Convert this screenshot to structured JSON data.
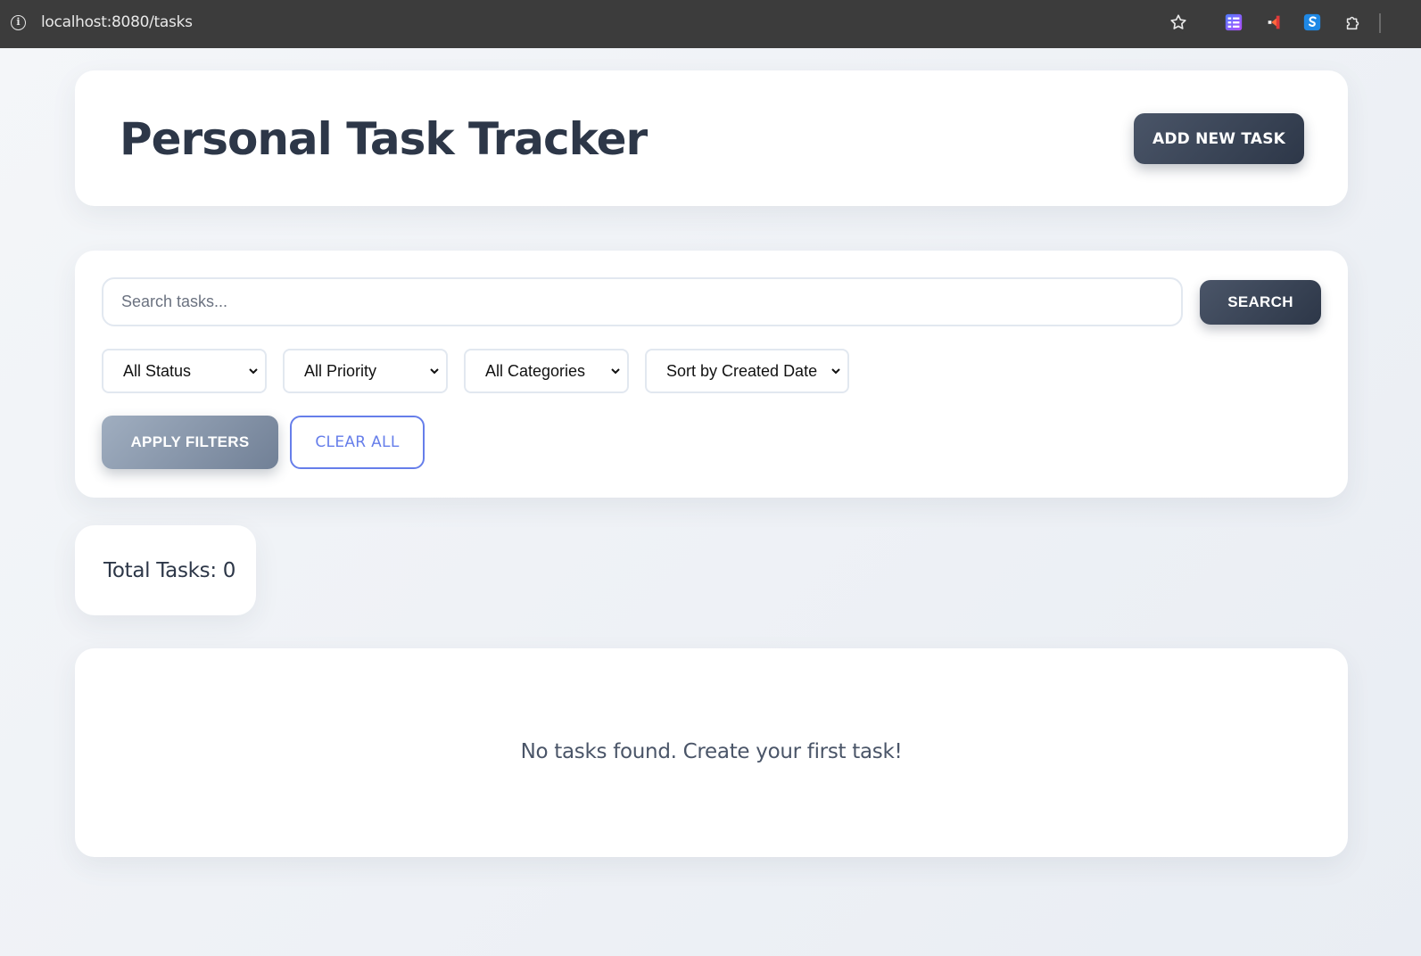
{
  "browser": {
    "url": "localhost:8080/tasks",
    "icons": [
      "info-icon",
      "star-icon",
      "extension-icon",
      "extension-icon",
      "extension-icon",
      "puzzle-icon"
    ]
  },
  "header": {
    "title": "Personal Task Tracker",
    "add_button_label": "ADD NEW TASK"
  },
  "filters": {
    "search_placeholder": "Search tasks...",
    "search_value": "",
    "search_button_label": "SEARCH",
    "status_selected": "All Status",
    "priority_selected": "All Priority",
    "category_selected": "All Categories",
    "sort_selected": "Sort by Created Date",
    "apply_button_label": "APPLY FILTERS",
    "clear_button_label": "CLEAR ALL"
  },
  "stats": {
    "total_tasks_text": "Total Tasks: 0"
  },
  "tasks": {
    "empty_message": "No tasks found. Create your first task!"
  },
  "colors": {
    "primary_dark": "#2d3748",
    "accent": "#667eea",
    "apply_button": "#8a96aa",
    "background": "#eef1f5"
  }
}
